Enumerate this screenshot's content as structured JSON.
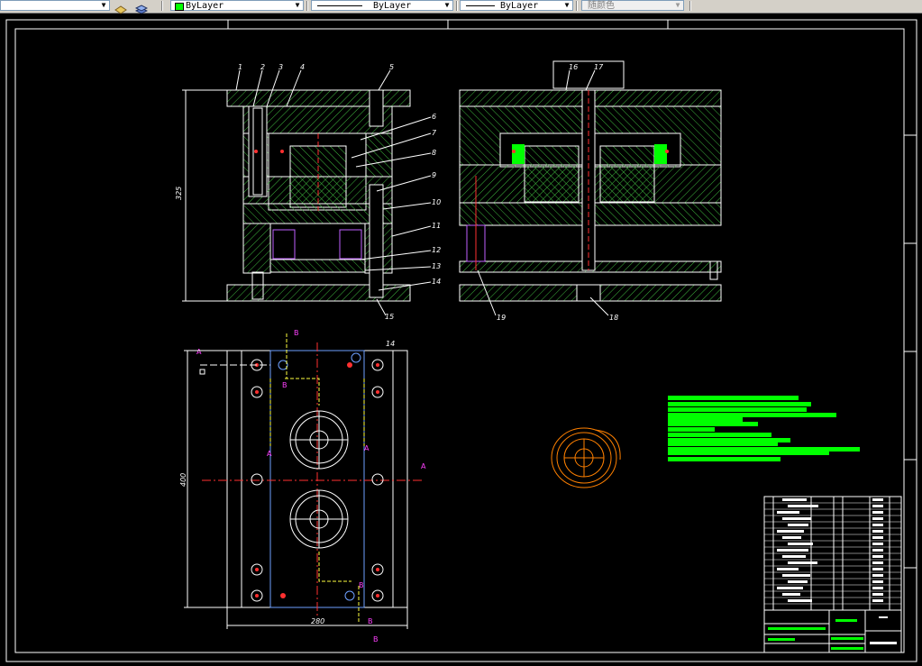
{
  "toolbar": {
    "color_value": "ByLayer",
    "linetype_value": "ByLayer",
    "lineweight_value": "ByLayer",
    "plotstyle_value": "随颜色",
    "layer_color": "#00ff00"
  },
  "drawing": {
    "balloons": [
      "1",
      "2",
      "3",
      "4",
      "5",
      "6",
      "7",
      "8",
      "9",
      "10",
      "11",
      "12",
      "13",
      "14",
      "15",
      "16",
      "17",
      "18",
      "19"
    ],
    "dim_height": "325",
    "dim_plan_height": "400",
    "dim_plan_width": "280",
    "plan_tag": "14",
    "section_a": "A",
    "section_b": "B"
  }
}
